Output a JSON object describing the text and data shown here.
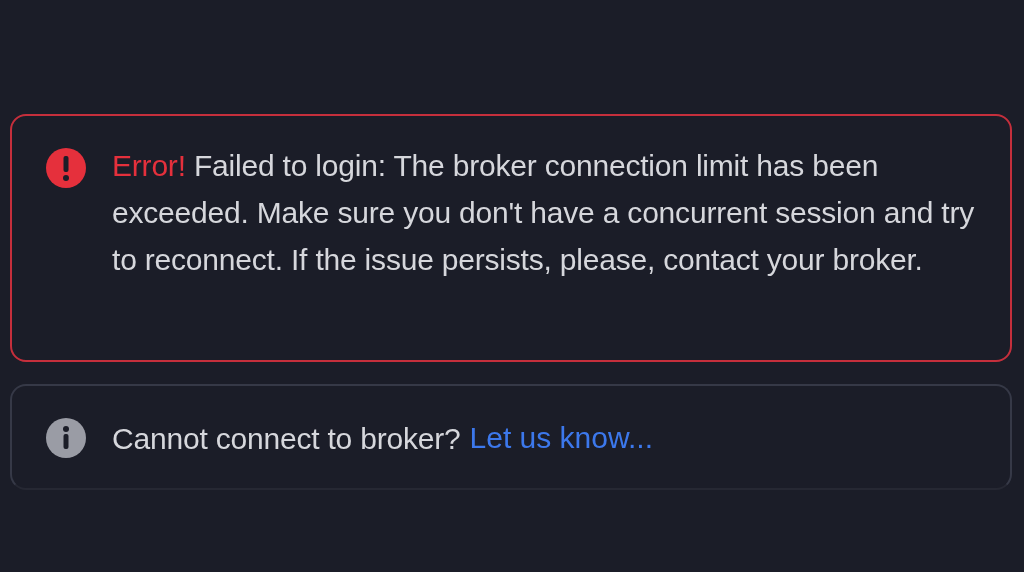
{
  "error_alert": {
    "message": "**Error!** Failed to login: The broker connection limit has been exceeded. Make sure you don't have a concurrent session and try to reconnect. If the issue persists, please, contact your broker."
  },
  "info_alert": {
    "text": "Cannot connect to broker?",
    "link": "Let us know..."
  }
}
